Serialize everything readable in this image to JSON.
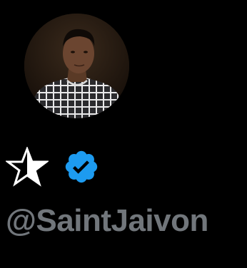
{
  "profile": {
    "display_name_icon": "star-icon",
    "badge_icon": "verified-badge-icon",
    "handle": "@SaintJaivon"
  },
  "colors": {
    "background": "#000000",
    "handle_text": "#71767b",
    "verified_blue": "#1d9bf0",
    "star_fill": "#ffffff",
    "star_outline": "#000000"
  }
}
